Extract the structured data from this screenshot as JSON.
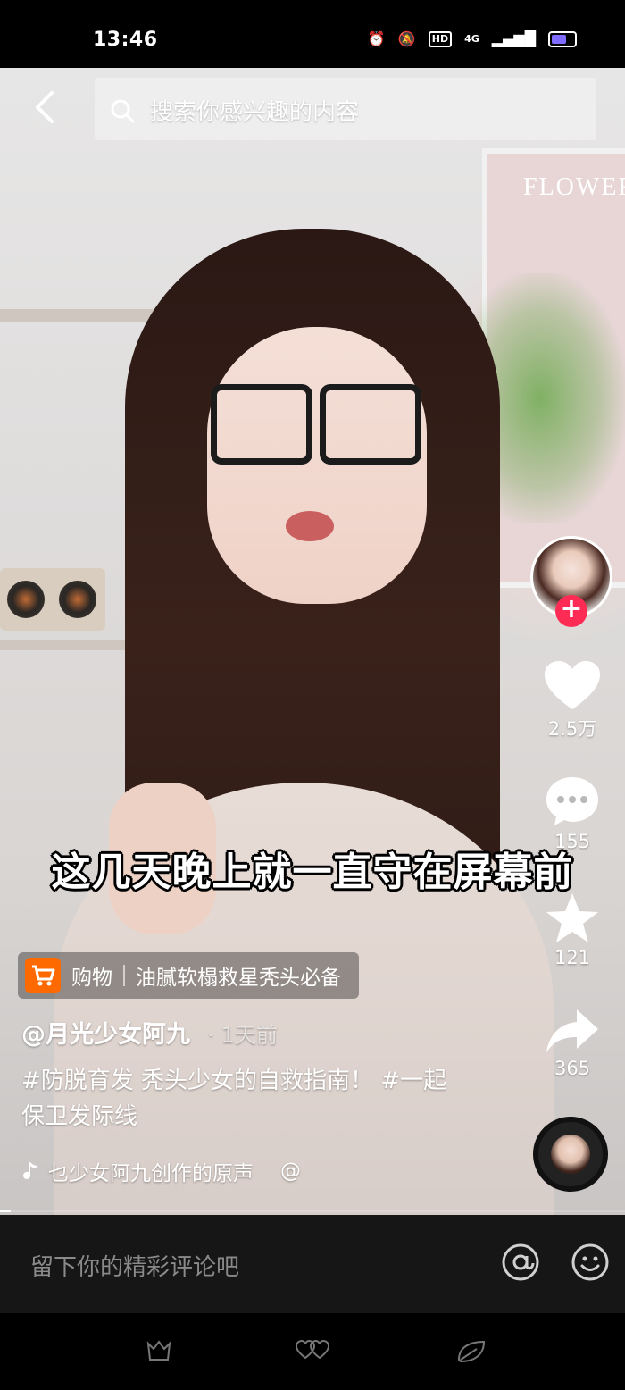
{
  "status_bar": {
    "time": "13:46",
    "hd": "HD",
    "network": "4G"
  },
  "search": {
    "placeholder": "搜索你感兴趣的内容"
  },
  "video": {
    "caption": "这几天晚上就一直守在屏幕前",
    "background_text": "FLOWER"
  },
  "actions": {
    "likes": "2.5万",
    "comments": "155",
    "favorites": "121",
    "shares": "365"
  },
  "shop": {
    "label": "购物",
    "title": "油腻软榻救星秃头必备"
  },
  "post": {
    "author": "@月光少女阿九",
    "time": "· 1天前",
    "description": "#防脱育发 秃头少女的自救指南！ #一起保卫发际线",
    "music": "乜少女阿九创作的原声",
    "music_at": "@"
  },
  "comment_bar": {
    "placeholder": "留下你的精彩评论吧"
  },
  "colors": {
    "accent": "#fe2c55",
    "shop": "#ff6a00"
  }
}
